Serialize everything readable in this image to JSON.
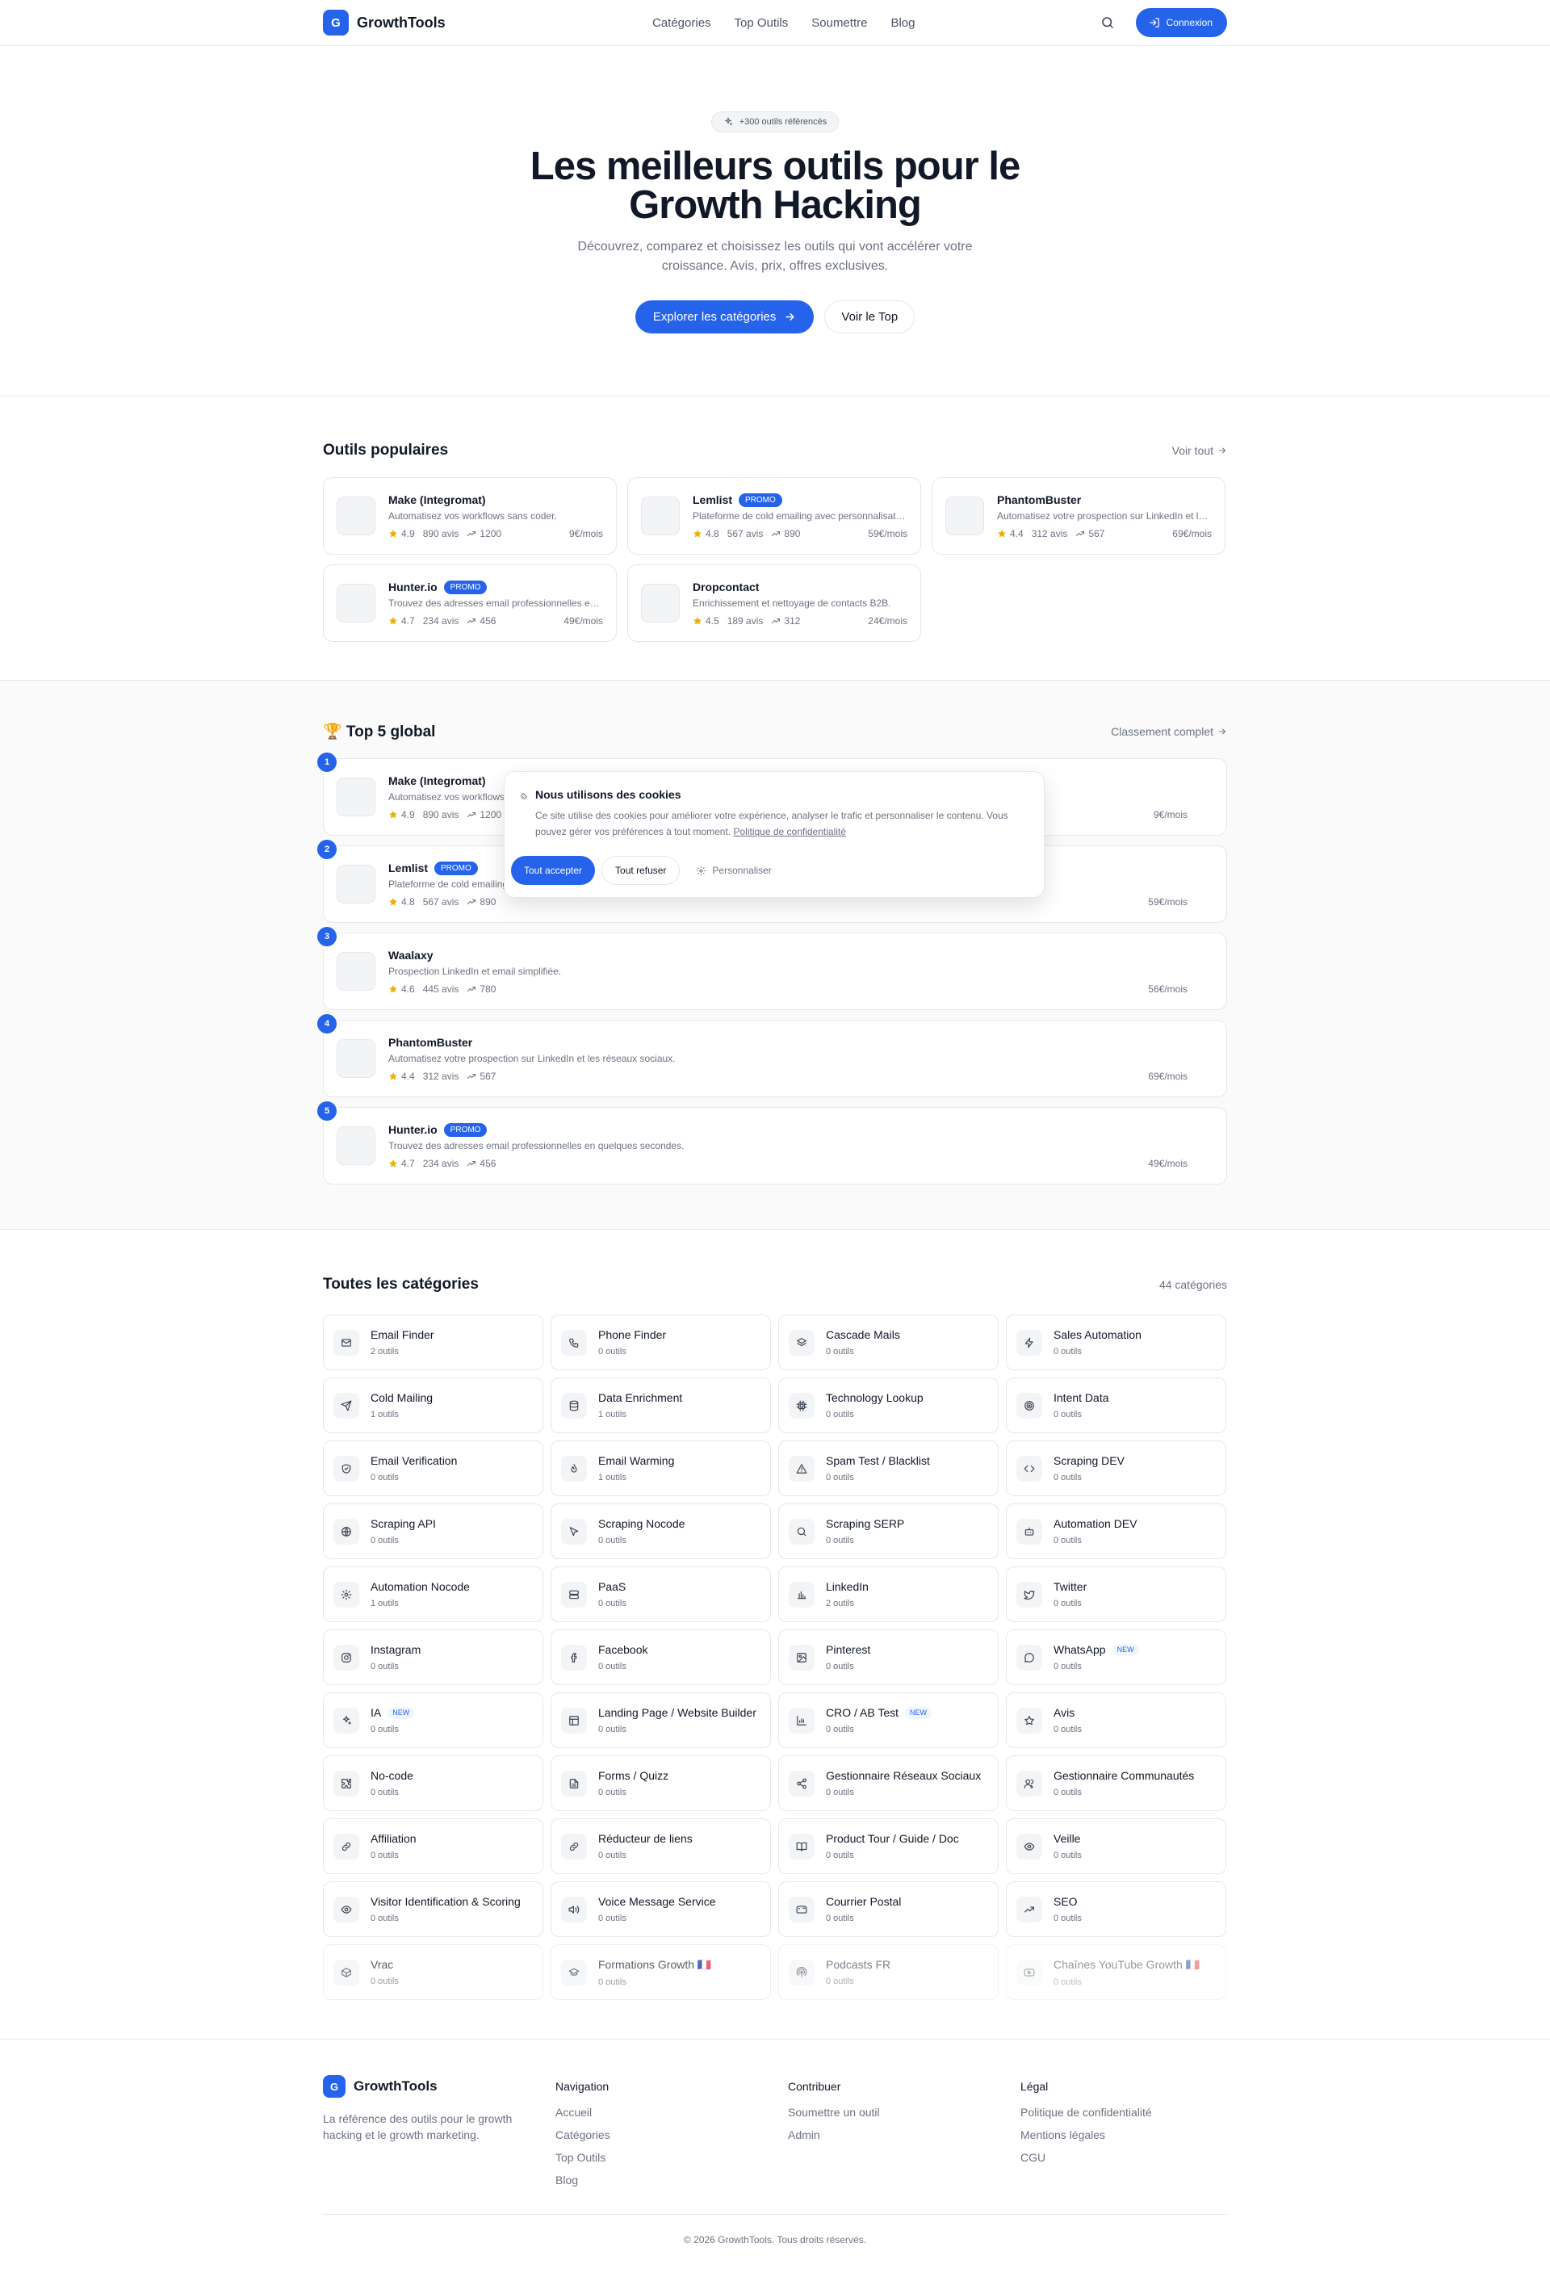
{
  "brand": {
    "letter": "G",
    "name": "GrowthTools",
    "color": "#2563eb"
  },
  "nav": {
    "items": [
      "Catégories",
      "Top Outils",
      "Soumettre",
      "Blog"
    ],
    "login_label": "Connexion",
    "search_icon": "search-icon"
  },
  "hero": {
    "badge": "+300 outils référencés",
    "title_line1": "Les meilleurs outils pour le",
    "title_line2": "Growth Hacking",
    "subtitle": "Découvrez, comparez et choisissez les outils qui vont accélérer votre croissance. Avis, prix, offres exclusives.",
    "cta_primary": "Explorer les catégories",
    "cta_secondary": "Voir le Top"
  },
  "popular": {
    "title": "Outils populaires",
    "link": "Voir tout",
    "tools": [
      {
        "name": "Make (Integromat)",
        "promo": "",
        "desc": "Automatisez vos workflows sans coder.",
        "rating": "4.9",
        "reviews": "890 avis",
        "trend": "1200",
        "price": "9€/mois"
      },
      {
        "name": "Lemlist",
        "promo": "PROMO",
        "desc": "Plateforme de cold emailing avec personnalisation avancée.",
        "rating": "4.8",
        "reviews": "567 avis",
        "trend": "890",
        "price": "59€/mois"
      },
      {
        "name": "PhantomBuster",
        "promo": "",
        "desc": "Automatisez votre prospection sur LinkedIn et les réseaux sociaux.",
        "rating": "4.4",
        "reviews": "312 avis",
        "trend": "567",
        "price": "69€/mois"
      },
      {
        "name": "Hunter.io",
        "promo": "PROMO",
        "desc": "Trouvez des adresses email professionnelles en quelques secondes.",
        "rating": "4.7",
        "reviews": "234 avis",
        "trend": "456",
        "price": "49€/mois"
      },
      {
        "name": "Dropcontact",
        "promo": "",
        "desc": "Enrichissement et nettoyage de contacts B2B.",
        "rating": "4.5",
        "reviews": "189 avis",
        "trend": "312",
        "price": "24€/mois"
      }
    ]
  },
  "top5": {
    "title": "🏆 Top 5 global",
    "link": "Classement complet",
    "tools": [
      {
        "rank": "1",
        "name": "Make (Integromat)",
        "promo": "",
        "desc": "Automatisez vos workflows sans coder.",
        "rating": "4.9",
        "reviews": "890 avis",
        "trend": "1200",
        "price": "9€/mois"
      },
      {
        "rank": "2",
        "name": "Lemlist",
        "promo": "PROMO",
        "desc": "Plateforme de cold emailing avec personnalisation avancée.",
        "rating": "4.8",
        "reviews": "567 avis",
        "trend": "890",
        "price": "59€/mois"
      },
      {
        "rank": "3",
        "name": "Waalaxy",
        "promo": "",
        "desc": "Prospection LinkedIn et email simplifiée.",
        "rating": "4.6",
        "reviews": "445 avis",
        "trend": "780",
        "price": "56€/mois"
      },
      {
        "rank": "4",
        "name": "PhantomBuster",
        "promo": "",
        "desc": "Automatisez votre prospection sur LinkedIn et les réseaux sociaux.",
        "rating": "4.4",
        "reviews": "312 avis",
        "trend": "567",
        "price": "69€/mois"
      },
      {
        "rank": "5",
        "name": "Hunter.io",
        "promo": "PROMO",
        "desc": "Trouvez des adresses email professionnelles en quelques secondes.",
        "rating": "4.7",
        "reviews": "234 avis",
        "trend": "456",
        "price": "49€/mois"
      }
    ]
  },
  "cookie": {
    "title": "Nous utilisons des cookies",
    "text": "Ce site utilise des cookies pour améliorer votre expérience, analyser le trafic et personnaliser le contenu. Vous pouvez gérer vos préférences à tout moment.",
    "policy_link": "Politique de confidentialité",
    "accept": "Tout accepter",
    "refuse": "Tout refuser",
    "customize": "Personnaliser"
  },
  "categories": {
    "title": "Toutes les catégories",
    "count": "44 catégories",
    "items": [
      {
        "name": "Email Finder",
        "count": "2 outils",
        "icon": "mail-icon",
        "badge": ""
      },
      {
        "name": "Phone Finder",
        "count": "0 outils",
        "icon": "phone-icon",
        "badge": ""
      },
      {
        "name": "Cascade Mails",
        "count": "0 outils",
        "icon": "layers-icon",
        "badge": ""
      },
      {
        "name": "Sales Automation",
        "count": "0 outils",
        "icon": "zap-icon",
        "badge": ""
      },
      {
        "name": "Cold Mailing",
        "count": "1 outils",
        "icon": "send-icon",
        "badge": ""
      },
      {
        "name": "Data Enrichment",
        "count": "1 outils",
        "icon": "database-icon",
        "badge": ""
      },
      {
        "name": "Technology Lookup",
        "count": "0 outils",
        "icon": "cpu-icon",
        "badge": ""
      },
      {
        "name": "Intent Data",
        "count": "0 outils",
        "icon": "target-icon",
        "badge": ""
      },
      {
        "name": "Email Verification",
        "count": "0 outils",
        "icon": "shield-check-icon",
        "badge": ""
      },
      {
        "name": "Email Warming",
        "count": "1 outils",
        "icon": "flame-icon",
        "badge": ""
      },
      {
        "name": "Spam Test / Blacklist",
        "count": "0 outils",
        "icon": "alert-triangle-icon",
        "badge": ""
      },
      {
        "name": "Scraping DEV",
        "count": "0 outils",
        "icon": "code-icon",
        "badge": ""
      },
      {
        "name": "Scraping API",
        "count": "0 outils",
        "icon": "globe-icon",
        "badge": ""
      },
      {
        "name": "Scraping Nocode",
        "count": "0 outils",
        "icon": "cursor-icon",
        "badge": ""
      },
      {
        "name": "Scraping SERP",
        "count": "0 outils",
        "icon": "search-icon",
        "badge": ""
      },
      {
        "name": "Automation DEV",
        "count": "0 outils",
        "icon": "bot-icon",
        "badge": ""
      },
      {
        "name": "Automation Nocode",
        "count": "1 outils",
        "icon": "settings-icon",
        "badge": ""
      },
      {
        "name": "PaaS",
        "count": "0 outils",
        "icon": "server-icon",
        "badge": ""
      },
      {
        "name": "LinkedIn",
        "count": "2 outils",
        "icon": "bar-chart-icon",
        "badge": ""
      },
      {
        "name": "Twitter",
        "count": "0 outils",
        "icon": "twitter-icon",
        "badge": ""
      },
      {
        "name": "Instagram",
        "count": "0 outils",
        "icon": "instagram-icon",
        "badge": ""
      },
      {
        "name": "Facebook",
        "count": "0 outils",
        "icon": "facebook-icon",
        "badge": ""
      },
      {
        "name": "Pinterest",
        "count": "0 outils",
        "icon": "image-icon",
        "badge": ""
      },
      {
        "name": "WhatsApp",
        "count": "0 outils",
        "icon": "message-circle-icon",
        "badge": "NEW"
      },
      {
        "name": "IA",
        "count": "0 outils",
        "icon": "sparkles-icon",
        "badge": "NEW"
      },
      {
        "name": "Landing Page / Website Builder",
        "count": "0 outils",
        "icon": "layout-icon",
        "badge": ""
      },
      {
        "name": "CRO / AB Test",
        "count": "0 outils",
        "icon": "chart-icon",
        "badge": "NEW"
      },
      {
        "name": "Avis",
        "count": "0 outils",
        "icon": "star-icon",
        "badge": ""
      },
      {
        "name": "No-code",
        "count": "0 outils",
        "icon": "puzzle-icon",
        "badge": ""
      },
      {
        "name": "Forms / Quizz",
        "count": "0 outils",
        "icon": "file-text-icon",
        "badge": ""
      },
      {
        "name": "Gestionnaire Réseaux Sociaux",
        "count": "0 outils",
        "icon": "share-icon",
        "badge": ""
      },
      {
        "name": "Gestionnaire Communautés",
        "count": "0 outils",
        "icon": "users-icon",
        "badge": ""
      },
      {
        "name": "Affiliation",
        "count": "0 outils",
        "icon": "link-icon",
        "badge": ""
      },
      {
        "name": "Réducteur de liens",
        "count": "0 outils",
        "icon": "link-icon",
        "badge": ""
      },
      {
        "name": "Product Tour / Guide / Doc",
        "count": "0 outils",
        "icon": "book-open-icon",
        "badge": ""
      },
      {
        "name": "Veille",
        "count": "0 outils",
        "icon": "eye-icon",
        "badge": ""
      },
      {
        "name": "Visitor Identification & Scoring",
        "count": "0 outils",
        "icon": "eye-icon",
        "badge": ""
      },
      {
        "name": "Voice Message Service",
        "count": "0 outils",
        "icon": "volume-icon",
        "badge": ""
      },
      {
        "name": "Courrier Postal",
        "count": "0 outils",
        "icon": "mailbox-icon",
        "badge": ""
      },
      {
        "name": "SEO",
        "count": "0 outils",
        "icon": "trending-up-icon",
        "badge": ""
      },
      {
        "name": "Vrac",
        "count": "0 outils",
        "icon": "box-icon",
        "badge": ""
      },
      {
        "name": "Formations Growth 🇫🇷",
        "count": "0 outils",
        "icon": "graduation-cap-icon",
        "badge": ""
      },
      {
        "name": "Podcasts FR",
        "count": "0 outils",
        "icon": "podcast-icon",
        "badge": ""
      },
      {
        "name": "Chaînes YouTube Growth 🇫🇷",
        "count": "0 outils",
        "icon": "youtube-icon",
        "badge": ""
      }
    ]
  },
  "footer": {
    "tagline": "La référence des outils pour le growth hacking et le growth marketing.",
    "columns": [
      {
        "title": "Navigation",
        "links": [
          "Accueil",
          "Catégories",
          "Top Outils",
          "Blog"
        ]
      },
      {
        "title": "Contribuer",
        "links": [
          "Soumettre un outil",
          "Admin"
        ]
      },
      {
        "title": "Légal",
        "links": [
          "Politique de confidentialité",
          "Mentions légales",
          "CGU"
        ]
      }
    ],
    "copyright": "© 2026 GrowthTools. Tous droits réservés."
  }
}
